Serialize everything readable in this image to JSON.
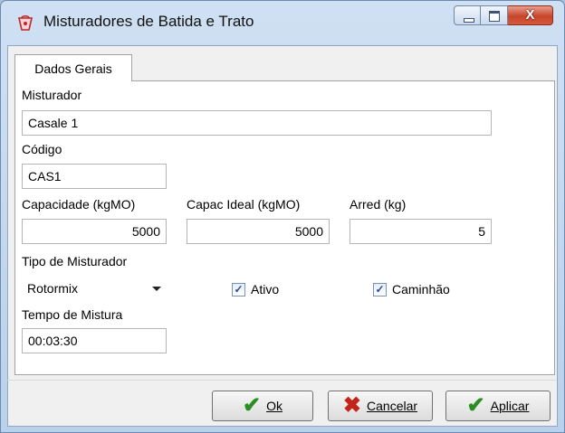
{
  "window": {
    "title": "Misturadores de Batida e Trato",
    "icon": "app-icon",
    "controls": {
      "close_glyph": "X"
    }
  },
  "tabs": [
    {
      "label": "Dados Gerais",
      "active": true
    }
  ],
  "form": {
    "misturador": {
      "label": "Misturador",
      "value": "Casale 1"
    },
    "codigo": {
      "label": "Código",
      "value": "CAS1"
    },
    "capacidade": {
      "label": "Capacidade (kgMO)",
      "value": "5000"
    },
    "capac_ideal": {
      "label": "Capac Ideal (kgMO)",
      "value": "5000"
    },
    "arred": {
      "label": "Arred (kg)",
      "value": "5"
    },
    "tipo": {
      "label": "Tipo de Misturador",
      "value": "Rotormix"
    },
    "ativo": {
      "label": "Ativo",
      "checked": true
    },
    "caminhao": {
      "label": "Caminhão",
      "checked": true
    },
    "tempo": {
      "label": "Tempo de Mistura",
      "value": "00:03:30"
    }
  },
  "buttons": {
    "ok": {
      "label": "Ok",
      "icon": "checkmark-icon"
    },
    "cancelar": {
      "label": "Cancelar",
      "icon": "x-icon"
    },
    "aplicar": {
      "label": "Aplicar",
      "icon": "checkmark-icon"
    }
  },
  "colors": {
    "accent": "#2a8f20",
    "danger": "#c22418",
    "titlebar": "#c3d7ee"
  }
}
